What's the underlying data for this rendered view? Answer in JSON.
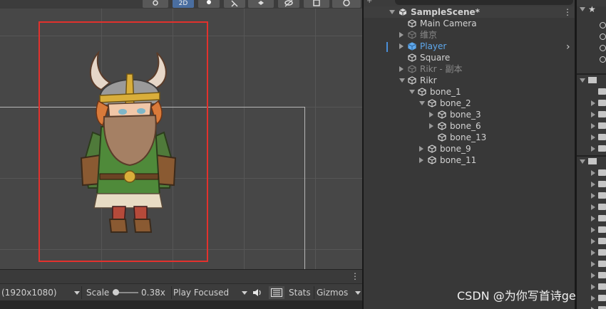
{
  "scene_toolbar": {
    "mode_2d_label": "2D"
  },
  "hierarchy": {
    "root": "SampleScene*",
    "items": [
      {
        "label": "Main Camera",
        "depth": 0,
        "arrow": "none",
        "state": "normal"
      },
      {
        "label": "维京",
        "depth": 0,
        "arrow": "right",
        "state": "disabled"
      },
      {
        "label": "Player",
        "depth": 0,
        "arrow": "right",
        "state": "selected"
      },
      {
        "label": "Square",
        "depth": 0,
        "arrow": "none",
        "state": "normal"
      },
      {
        "label": "Rikr - 副本",
        "depth": 0,
        "arrow": "right",
        "state": "disabled"
      },
      {
        "label": "Rikr",
        "depth": 0,
        "arrow": "down",
        "state": "normal"
      },
      {
        "label": "bone_1",
        "depth": 1,
        "arrow": "down",
        "state": "normal"
      },
      {
        "label": "bone_2",
        "depth": 2,
        "arrow": "down",
        "state": "normal"
      },
      {
        "label": "bone_3",
        "depth": 3,
        "arrow": "right",
        "state": "normal"
      },
      {
        "label": "bone_6",
        "depth": 3,
        "arrow": "right",
        "state": "normal"
      },
      {
        "label": "bone_13",
        "depth": 3,
        "arrow": "none",
        "state": "normal"
      },
      {
        "label": "bone_9",
        "depth": 2,
        "arrow": "right",
        "state": "normal"
      },
      {
        "label": "bone_11",
        "depth": 2,
        "arrow": "right",
        "state": "normal"
      }
    ]
  },
  "game_toolbar": {
    "resolution": "(1920x1080)",
    "scale_label": "Scale",
    "scale_value": "0.38x",
    "scale_fraction": 0.12,
    "play_mode": "Play Focused",
    "stats_label": "Stats",
    "gizmos_label": "Gizmos"
  },
  "project_panel": {
    "folder_count": 13
  },
  "watermark": "CSDN @为你写首诗ge",
  "colors": {
    "selection_rect": "#e2312d",
    "selected_item": "#5ea8ec",
    "scene_bg": "#474747"
  },
  "icons": [
    "gear-icon",
    "lightbulb-icon",
    "audio-icon",
    "fx-icon",
    "layers-icon",
    "eye-icon",
    "gizmo-icon",
    "cube-icon",
    "speaker-icon",
    "stats-icon",
    "folder-icon",
    "star-icon",
    "search-icon"
  ]
}
